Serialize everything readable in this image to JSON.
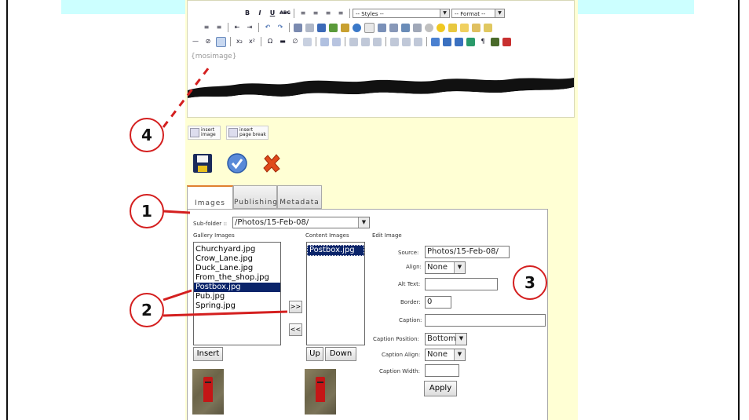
{
  "editor": {
    "styles_select": "-- Styles --",
    "format_select": "-- Format --",
    "placeholder_text": "{mosimage}"
  },
  "insert_buttons": [
    {
      "line1": "insert",
      "line2": "image"
    },
    {
      "line1": "insert",
      "line2": "page break"
    }
  ],
  "tabs": [
    "Images",
    "Publishing",
    "Metadata"
  ],
  "images_tab": {
    "subfolder_label": "Sub-folder ::",
    "subfolder_value": "/Photos/15-Feb-08/",
    "gallery_label": "Gallery Images",
    "gallery_items": [
      "Churchyard.jpg",
      "Crow_Lane.jpg",
      "Duck_Lane.jpg",
      "From_the_shop.jpg",
      "Postbox.jpg",
      "Pub.jpg",
      "Spring.jpg"
    ],
    "gallery_selected": "Postbox.jpg",
    "content_label": "Content Images",
    "content_items": [
      "Postbox.jpg"
    ],
    "add_button": ">>",
    "remove_button": "<<",
    "insert_button": "Insert",
    "up_button": "Up",
    "down_button": "Down",
    "edit_label": "Edit Image",
    "source_label": "Source:",
    "source_value": "Photos/15-Feb-08/",
    "align_label": "Align:",
    "align_value": "None",
    "alt_label": "Alt Text:",
    "alt_value": "",
    "border_label": "Border:",
    "border_value": "0",
    "caption_label": "Caption:",
    "caption_value": "",
    "caption_position_label": "Caption Position:",
    "caption_position_value": "Bottom",
    "caption_align_label": "Caption Align:",
    "caption_align_value": "None",
    "caption_width_label": "Caption Width:",
    "caption_width_value": "",
    "apply_button": "Apply"
  },
  "callouts": [
    "1",
    "2",
    "3",
    "4"
  ],
  "colors": {
    "panel_bg": "#ffffd4",
    "top_band": "#ccffff",
    "callout_ring": "#d41f1f",
    "selection": "#0a246a"
  }
}
